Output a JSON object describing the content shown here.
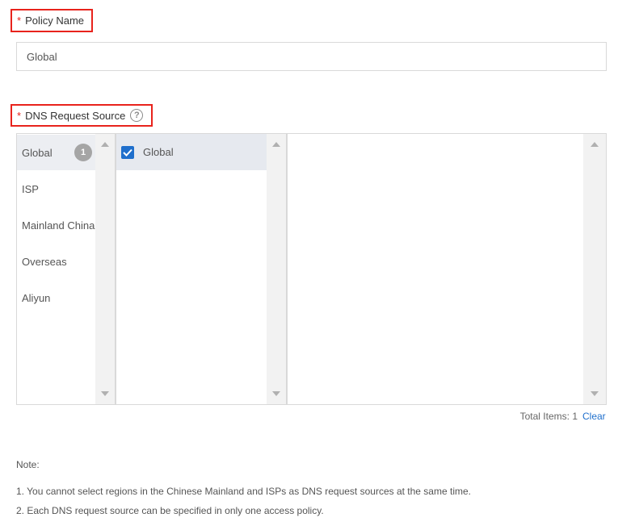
{
  "policy_name": {
    "required_mark": "*",
    "label": "Policy Name",
    "value": "Global"
  },
  "dns_request_source": {
    "required_mark": "*",
    "label": "DNS Request Source",
    "help_icon": "question-circle-icon",
    "help_glyph": "?"
  },
  "categories": [
    {
      "label": "Global",
      "badge": "1",
      "active": true
    },
    {
      "label": "ISP"
    },
    {
      "label": "Mainland China"
    },
    {
      "label": "Overseas"
    },
    {
      "label": "Aliyun"
    }
  ],
  "options": [
    {
      "label": "Global",
      "checked": true
    }
  ],
  "footer": {
    "total_label": "Total Items: 1",
    "clear_label": "Clear"
  },
  "note": {
    "title": "Note:",
    "lines": [
      "1. You cannot select regions in the Chinese Mainland and ISPs as DNS request sources at the same time.",
      "2. Each DNS request source can be specified in only one access policy."
    ]
  },
  "colors": {
    "required": "#e8231c",
    "checkbox": "#1f6fcc",
    "link": "#1f6fcc",
    "badge": "#a5a5a5"
  }
}
